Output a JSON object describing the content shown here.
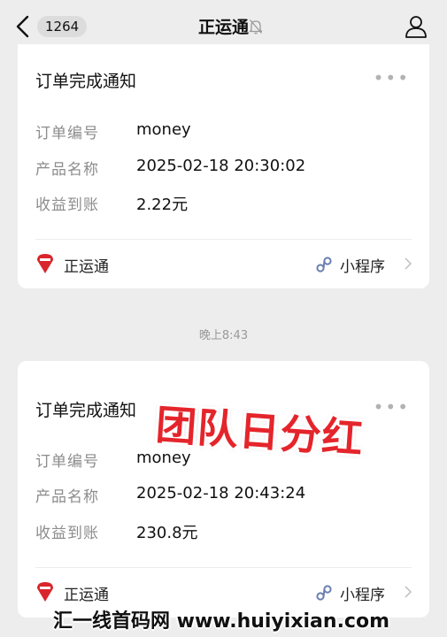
{
  "header": {
    "unread_count": "1264",
    "title": "正运通"
  },
  "cards": [
    {
      "title": "订单完成通知",
      "more": "•••",
      "rows": [
        {
          "label": "订单编号",
          "value": "money"
        },
        {
          "label": "产品名称",
          "value": "2025-02-18 20:30:02"
        },
        {
          "label": "收益到账",
          "value": "2.22元"
        }
      ],
      "brand": "正运通",
      "miniprogram_label": "小程序"
    },
    {
      "title": "订单完成通知",
      "more": "•••",
      "rows": [
        {
          "label": "订单编号",
          "value": "money"
        },
        {
          "label": "产品名称",
          "value": "2025-02-18 20:43:24"
        },
        {
          "label": "收益到账",
          "value": "230.8元"
        }
      ],
      "brand": "正运通",
      "miniprogram_label": "小程序"
    }
  ],
  "timestamp": "晚上8:43",
  "overlay_stamp": "团队日分红",
  "footer_watermark": "汇一线首码网 www.huiyixian.com",
  "colors": {
    "background": "#ededed",
    "card": "#ffffff",
    "label": "#8c8c8c",
    "stamp": "#e4252b",
    "brand_logo": "#d9262c"
  }
}
